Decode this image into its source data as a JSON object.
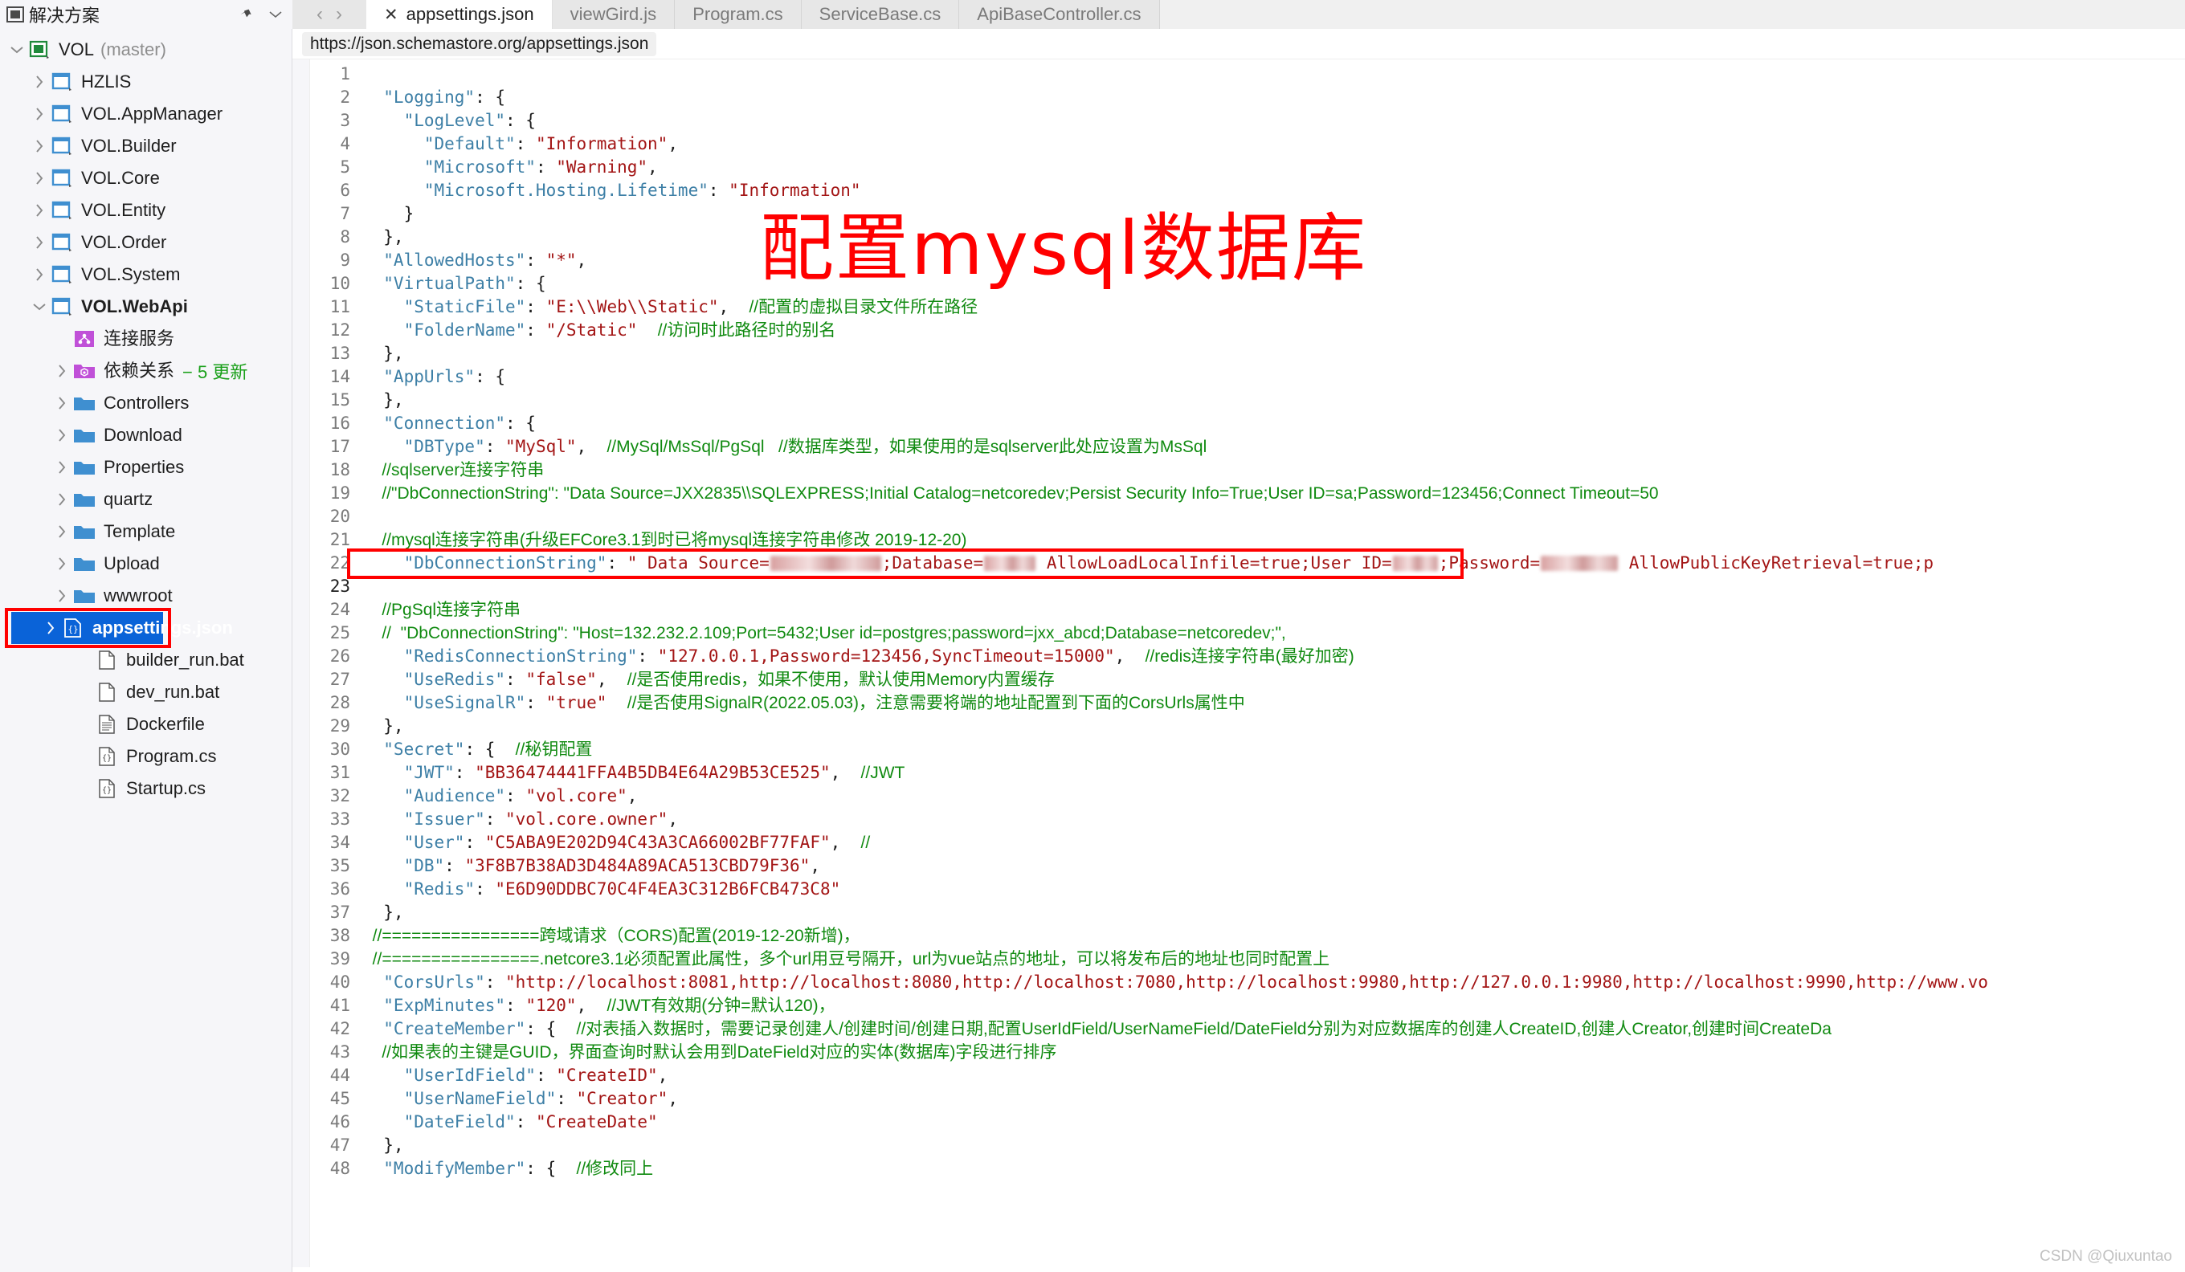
{
  "window": {
    "solution_panel_title": "解决方案",
    "icons": {
      "solution": "solution-icon",
      "pin": "pin-icon",
      "chevron_down": "chevron-down-icon",
      "nav_back": "‹",
      "nav_forward": "›"
    }
  },
  "tabs": [
    {
      "label": "appsettings.json",
      "active": true,
      "close": "✕"
    },
    {
      "label": "viewGird.js",
      "active": false
    },
    {
      "label": "Program.cs",
      "active": false
    },
    {
      "label": "ServiceBase.cs",
      "active": false
    },
    {
      "label": "ApiBaseController.cs",
      "active": false
    }
  ],
  "explorer": {
    "items": [
      {
        "label": "VOL",
        "sub": "(master)",
        "indent": 0,
        "chevron": "v",
        "icon": "solution-icon",
        "bold": false
      },
      {
        "label": "HZLIS",
        "indent": 1,
        "chevron": ">",
        "icon": "project-icon"
      },
      {
        "label": "VOL.AppManager",
        "indent": 1,
        "chevron": ">",
        "icon": "project-icon"
      },
      {
        "label": "VOL.Builder",
        "indent": 1,
        "chevron": ">",
        "icon": "project-icon"
      },
      {
        "label": "VOL.Core",
        "indent": 1,
        "chevron": ">",
        "icon": "project-icon"
      },
      {
        "label": "VOL.Entity",
        "indent": 1,
        "chevron": ">",
        "icon": "project-icon"
      },
      {
        "label": "VOL.Order",
        "indent": 1,
        "chevron": ">",
        "icon": "project-icon"
      },
      {
        "label": "VOL.System",
        "indent": 1,
        "chevron": ">",
        "icon": "project-icon"
      },
      {
        "label": "VOL.WebApi",
        "indent": 1,
        "chevron": "v",
        "icon": "project-icon",
        "bold": true
      },
      {
        "label": "连接服务",
        "indent": 2,
        "chevron": "",
        "icon": "connected-services-icon"
      },
      {
        "label": "依赖关系",
        "badge": "− 5 更新",
        "indent": 2,
        "chevron": ">",
        "icon": "dependencies-icon"
      },
      {
        "label": "Controllers",
        "indent": 2,
        "chevron": ">",
        "icon": "folder-icon"
      },
      {
        "label": "Download",
        "indent": 2,
        "chevron": ">",
        "icon": "folder-icon"
      },
      {
        "label": "Properties",
        "indent": 2,
        "chevron": ">",
        "icon": "folder-icon"
      },
      {
        "label": "quartz",
        "indent": 2,
        "chevron": ">",
        "icon": "folder-icon"
      },
      {
        "label": "Template",
        "indent": 2,
        "chevron": ">",
        "icon": "folder-icon"
      },
      {
        "label": "Upload",
        "indent": 2,
        "chevron": ">",
        "icon": "folder-icon"
      },
      {
        "label": "wwwroot",
        "indent": 2,
        "chevron": ">",
        "icon": "folder-icon"
      },
      {
        "label": "appsettings.json",
        "indent": 2,
        "chevron": ">",
        "icon": "json-file-icon",
        "selected": true,
        "highlighted": true
      },
      {
        "label": "builder_run.bat",
        "indent": 3,
        "chevron": "",
        "icon": "file-icon"
      },
      {
        "label": "dev_run.bat",
        "indent": 3,
        "chevron": "",
        "icon": "file-icon"
      },
      {
        "label": "Dockerfile",
        "indent": 3,
        "chevron": "",
        "icon": "text-file-icon"
      },
      {
        "label": "Program.cs",
        "indent": 3,
        "chevron": "",
        "icon": "cs-file-icon"
      },
      {
        "label": "Startup.cs",
        "indent": 3,
        "chevron": "",
        "icon": "cs-file-icon"
      }
    ]
  },
  "editor": {
    "schema_url": "https://json.schemastore.org/appsettings.json",
    "current_line": 23,
    "lines": [
      {
        "n": 1,
        "tokens": []
      },
      {
        "n": 2,
        "tokens": [
          {
            "t": "k",
            "v": "  \"Logging\""
          },
          {
            "t": "p",
            "v": ": {"
          }
        ]
      },
      {
        "n": 3,
        "tokens": [
          {
            "t": "k",
            "v": "    \"LogLevel\""
          },
          {
            "t": "p",
            "v": ": {"
          }
        ]
      },
      {
        "n": 4,
        "tokens": [
          {
            "t": "k",
            "v": "      \"Default\""
          },
          {
            "t": "p",
            "v": ": "
          },
          {
            "t": "s",
            "v": "\"Information\""
          },
          {
            "t": "p",
            "v": ","
          }
        ]
      },
      {
        "n": 5,
        "tokens": [
          {
            "t": "k",
            "v": "      \"Microsoft\""
          },
          {
            "t": "p",
            "v": ": "
          },
          {
            "t": "s",
            "v": "\"Warning\""
          },
          {
            "t": "p",
            "v": ","
          }
        ]
      },
      {
        "n": 6,
        "tokens": [
          {
            "t": "k",
            "v": "      \"Microsoft.Hosting.Lifetime\""
          },
          {
            "t": "p",
            "v": ": "
          },
          {
            "t": "s",
            "v": "\"Information\""
          }
        ]
      },
      {
        "n": 7,
        "tokens": [
          {
            "t": "p",
            "v": "    }"
          }
        ]
      },
      {
        "n": 8,
        "tokens": [
          {
            "t": "p",
            "v": "  },"
          }
        ]
      },
      {
        "n": 9,
        "tokens": [
          {
            "t": "k",
            "v": "  \"AllowedHosts\""
          },
          {
            "t": "p",
            "v": ": "
          },
          {
            "t": "s",
            "v": "\"*\""
          },
          {
            "t": "p",
            "v": ","
          }
        ]
      },
      {
        "n": 10,
        "tokens": [
          {
            "t": "k",
            "v": "  \"VirtualPath\""
          },
          {
            "t": "p",
            "v": ": {"
          }
        ]
      },
      {
        "n": 11,
        "tokens": [
          {
            "t": "k",
            "v": "    \"StaticFile\""
          },
          {
            "t": "p",
            "v": ": "
          },
          {
            "t": "s",
            "v": "\"E:\\\\Web\\\\Static\""
          },
          {
            "t": "p",
            "v": ",  "
          },
          {
            "t": "cmz",
            "v": "//配置的虚拟目录文件所在路径"
          }
        ]
      },
      {
        "n": 12,
        "tokens": [
          {
            "t": "k",
            "v": "    \"FolderName\""
          },
          {
            "t": "p",
            "v": ": "
          },
          {
            "t": "s",
            "v": "\"/Static\""
          },
          {
            "t": "p",
            "v": "  "
          },
          {
            "t": "cmz",
            "v": "//访问时此路径时的别名"
          }
        ]
      },
      {
        "n": 13,
        "tokens": [
          {
            "t": "p",
            "v": "  },"
          }
        ]
      },
      {
        "n": 14,
        "tokens": [
          {
            "t": "k",
            "v": "  \"AppUrls\""
          },
          {
            "t": "p",
            "v": ": {"
          }
        ]
      },
      {
        "n": 15,
        "tokens": [
          {
            "t": "p",
            "v": "  },"
          }
        ]
      },
      {
        "n": 16,
        "tokens": [
          {
            "t": "k",
            "v": "  \"Connection\""
          },
          {
            "t": "p",
            "v": ": {"
          }
        ]
      },
      {
        "n": 17,
        "tokens": [
          {
            "t": "k",
            "v": "    \"DBType\""
          },
          {
            "t": "p",
            "v": ": "
          },
          {
            "t": "s",
            "v": "\"MySql\""
          },
          {
            "t": "p",
            "v": ",  "
          },
          {
            "t": "cmz",
            "v": "//MySql/MsSql/PgSql   //数据库类型，如果使用的是sqlserver此处应设置为MsSql"
          }
        ]
      },
      {
        "n": 18,
        "tokens": [
          {
            "t": "cmz",
            "v": "    //sqlserver连接字符串"
          }
        ]
      },
      {
        "n": 19,
        "tokens": [
          {
            "t": "cmz",
            "v": "    //\"DbConnectionString\": \"Data Source=JXX2835\\\\SQLEXPRESS;Initial Catalog=netcoredev;Persist Security Info=True;User ID=sa;Password=123456;Connect Timeout=50"
          }
        ]
      },
      {
        "n": 20,
        "tokens": []
      },
      {
        "n": 21,
        "tokens": [
          {
            "t": "cmz",
            "v": "    //mysql连接字符串(升级EFCore3.1到时已将mysql连接字符串修改 2019-12-20)"
          }
        ]
      },
      {
        "n": 22,
        "tokens": [
          {
            "t": "k",
            "v": "    \"DbConnectionString\""
          },
          {
            "t": "p",
            "v": ": "
          },
          {
            "t": "s",
            "v": "\" Data Source="
          },
          {
            "t": "redact",
            "v": "138"
          },
          {
            "t": "s",
            "v": ";Database="
          },
          {
            "t": "redact",
            "v": "64"
          },
          {
            "t": "s",
            "v": " AllowLoadLocalInfile=true;User ID="
          },
          {
            "t": "redact",
            "v": "56"
          },
          {
            "t": "s",
            "v": ";Password="
          },
          {
            "t": "redact",
            "v": "96"
          },
          {
            "t": "s",
            "v": " AllowPublicKeyRetrieval=true;p"
          }
        ]
      },
      {
        "n": 23,
        "tokens": [],
        "current": true
      },
      {
        "n": 24,
        "tokens": [
          {
            "t": "cmz",
            "v": "    //PgSql连接字符串"
          }
        ]
      },
      {
        "n": 25,
        "tokens": [
          {
            "t": "cmz",
            "v": "    //  \"DbConnectionString\": \"Host=132.232.2.109;Port=5432;User id=postgres;password=jxx_abcd;Database=netcoredev;\","
          }
        ]
      },
      {
        "n": 26,
        "tokens": [
          {
            "t": "k",
            "v": "    \"RedisConnectionString\""
          },
          {
            "t": "p",
            "v": ": "
          },
          {
            "t": "s",
            "v": "\"127.0.0.1,Password=123456,SyncTimeout=15000\""
          },
          {
            "t": "p",
            "v": ",  "
          },
          {
            "t": "cmz",
            "v": "//redis连接字符串(最好加密)"
          }
        ]
      },
      {
        "n": 27,
        "tokens": [
          {
            "t": "k",
            "v": "    \"UseRedis\""
          },
          {
            "t": "p",
            "v": ": "
          },
          {
            "t": "s",
            "v": "\"false\""
          },
          {
            "t": "p",
            "v": ",  "
          },
          {
            "t": "cmz",
            "v": "//是否使用redis，如果不使用，默认使用Memory内置缓存"
          }
        ]
      },
      {
        "n": 28,
        "tokens": [
          {
            "t": "k",
            "v": "    \"UseSignalR\""
          },
          {
            "t": "p",
            "v": ": "
          },
          {
            "t": "s",
            "v": "\"true\""
          },
          {
            "t": "p",
            "v": "  "
          },
          {
            "t": "cmz",
            "v": "//是否使用SignalR(2022.05.03)，注意需要将端的地址配置到下面的CorsUrls属性中"
          }
        ]
      },
      {
        "n": 29,
        "tokens": [
          {
            "t": "p",
            "v": "  },"
          }
        ]
      },
      {
        "n": 30,
        "tokens": [
          {
            "t": "k",
            "v": "  \"Secret\""
          },
          {
            "t": "p",
            "v": ": {  "
          },
          {
            "t": "cmz",
            "v": "//秘钥配置"
          }
        ]
      },
      {
        "n": 31,
        "tokens": [
          {
            "t": "k",
            "v": "    \"JWT\""
          },
          {
            "t": "p",
            "v": ": "
          },
          {
            "t": "s",
            "v": "\"BB36474441FFA4B5DB4E64A29B53CE525\""
          },
          {
            "t": "p",
            "v": ",  "
          },
          {
            "t": "cmz",
            "v": "//JWT"
          }
        ]
      },
      {
        "n": 32,
        "tokens": [
          {
            "t": "k",
            "v": "    \"Audience\""
          },
          {
            "t": "p",
            "v": ": "
          },
          {
            "t": "s",
            "v": "\"vol.core\""
          },
          {
            "t": "p",
            "v": ","
          }
        ]
      },
      {
        "n": 33,
        "tokens": [
          {
            "t": "k",
            "v": "    \"Issuer\""
          },
          {
            "t": "p",
            "v": ": "
          },
          {
            "t": "s",
            "v": "\"vol.core.owner\""
          },
          {
            "t": "p",
            "v": ","
          }
        ]
      },
      {
        "n": 34,
        "tokens": [
          {
            "t": "k",
            "v": "    \"User\""
          },
          {
            "t": "p",
            "v": ": "
          },
          {
            "t": "s",
            "v": "\"C5ABA9E202D94C43A3CA66002BF77FAF\""
          },
          {
            "t": "p",
            "v": ",  "
          },
          {
            "t": "cmz",
            "v": "//"
          }
        ]
      },
      {
        "n": 35,
        "tokens": [
          {
            "t": "k",
            "v": "    \"DB\""
          },
          {
            "t": "p",
            "v": ": "
          },
          {
            "t": "s",
            "v": "\"3F8B7B38AD3D484A89ACA513CBD79F36\""
          },
          {
            "t": "p",
            "v": ","
          }
        ]
      },
      {
        "n": 36,
        "tokens": [
          {
            "t": "k",
            "v": "    \"Redis\""
          },
          {
            "t": "p",
            "v": ": "
          },
          {
            "t": "s",
            "v": "\"E6D90DDBC70C4F4EA3C312B6FCB473C8\""
          }
        ]
      },
      {
        "n": 37,
        "tokens": [
          {
            "t": "p",
            "v": "  },"
          }
        ]
      },
      {
        "n": 38,
        "tokens": [
          {
            "t": "cmz",
            "v": "  //================跨域请求（CORS)配置(2019-12-20新增)，"
          }
        ]
      },
      {
        "n": 39,
        "tokens": [
          {
            "t": "cmz",
            "v": "  //================.netcore3.1必须配置此属性，多个url用豆号隔开，url为vue站点的地址，可以将发布后的地址也同时配置上"
          }
        ]
      },
      {
        "n": 40,
        "tokens": [
          {
            "t": "k",
            "v": "  \"CorsUrls\""
          },
          {
            "t": "p",
            "v": ": "
          },
          {
            "t": "s",
            "v": "\"http://localhost:8081,http://localhost:8080,http://localhost:7080,http://localhost:9980,http://127.0.0.1:9980,http://localhost:9990,http://www.vo"
          }
        ]
      },
      {
        "n": 41,
        "tokens": [
          {
            "t": "k",
            "v": "  \"ExpMinutes\""
          },
          {
            "t": "p",
            "v": ": "
          },
          {
            "t": "s",
            "v": "\"120\""
          },
          {
            "t": "p",
            "v": ",  "
          },
          {
            "t": "cmz",
            "v": "//JWT有效期(分钟=默认120)，"
          }
        ]
      },
      {
        "n": 42,
        "tokens": [
          {
            "t": "k",
            "v": "  \"CreateMember\""
          },
          {
            "t": "p",
            "v": ": {  "
          },
          {
            "t": "cmz",
            "v": "//对表插入数据时，需要记录创建人/创建时间/创建日期,配置UserIdField/UserNameField/DateField分别为对应数据库的创建人CreateID,创建人Creator,创建时间CreateDa"
          }
        ]
      },
      {
        "n": 43,
        "tokens": [
          {
            "t": "cmz",
            "v": "    //如果表的主键是GUID，界面查询时默认会用到DateField对应的实体(数据库)字段进行排序"
          }
        ]
      },
      {
        "n": 44,
        "tokens": [
          {
            "t": "k",
            "v": "    \"UserIdField\""
          },
          {
            "t": "p",
            "v": ": "
          },
          {
            "t": "s",
            "v": "\"CreateID\""
          },
          {
            "t": "p",
            "v": ","
          }
        ]
      },
      {
        "n": 45,
        "tokens": [
          {
            "t": "k",
            "v": "    \"UserNameField\""
          },
          {
            "t": "p",
            "v": ": "
          },
          {
            "t": "s",
            "v": "\"Creator\""
          },
          {
            "t": "p",
            "v": ","
          }
        ]
      },
      {
        "n": 46,
        "tokens": [
          {
            "t": "k",
            "v": "    \"DateField\""
          },
          {
            "t": "p",
            "v": ": "
          },
          {
            "t": "s",
            "v": "\"CreateDate\""
          }
        ]
      },
      {
        "n": 47,
        "tokens": [
          {
            "t": "p",
            "v": "  },"
          }
        ]
      },
      {
        "n": 48,
        "tokens": [
          {
            "t": "k",
            "v": "  \"ModifyMember\""
          },
          {
            "t": "p",
            "v": ": {  "
          },
          {
            "t": "cmz",
            "v": "//修改同上"
          }
        ]
      }
    ]
  },
  "annotation": {
    "text": "配置mysql数据库",
    "color": "#ff0000"
  },
  "watermark": "CSDN @Qiuxuntao"
}
